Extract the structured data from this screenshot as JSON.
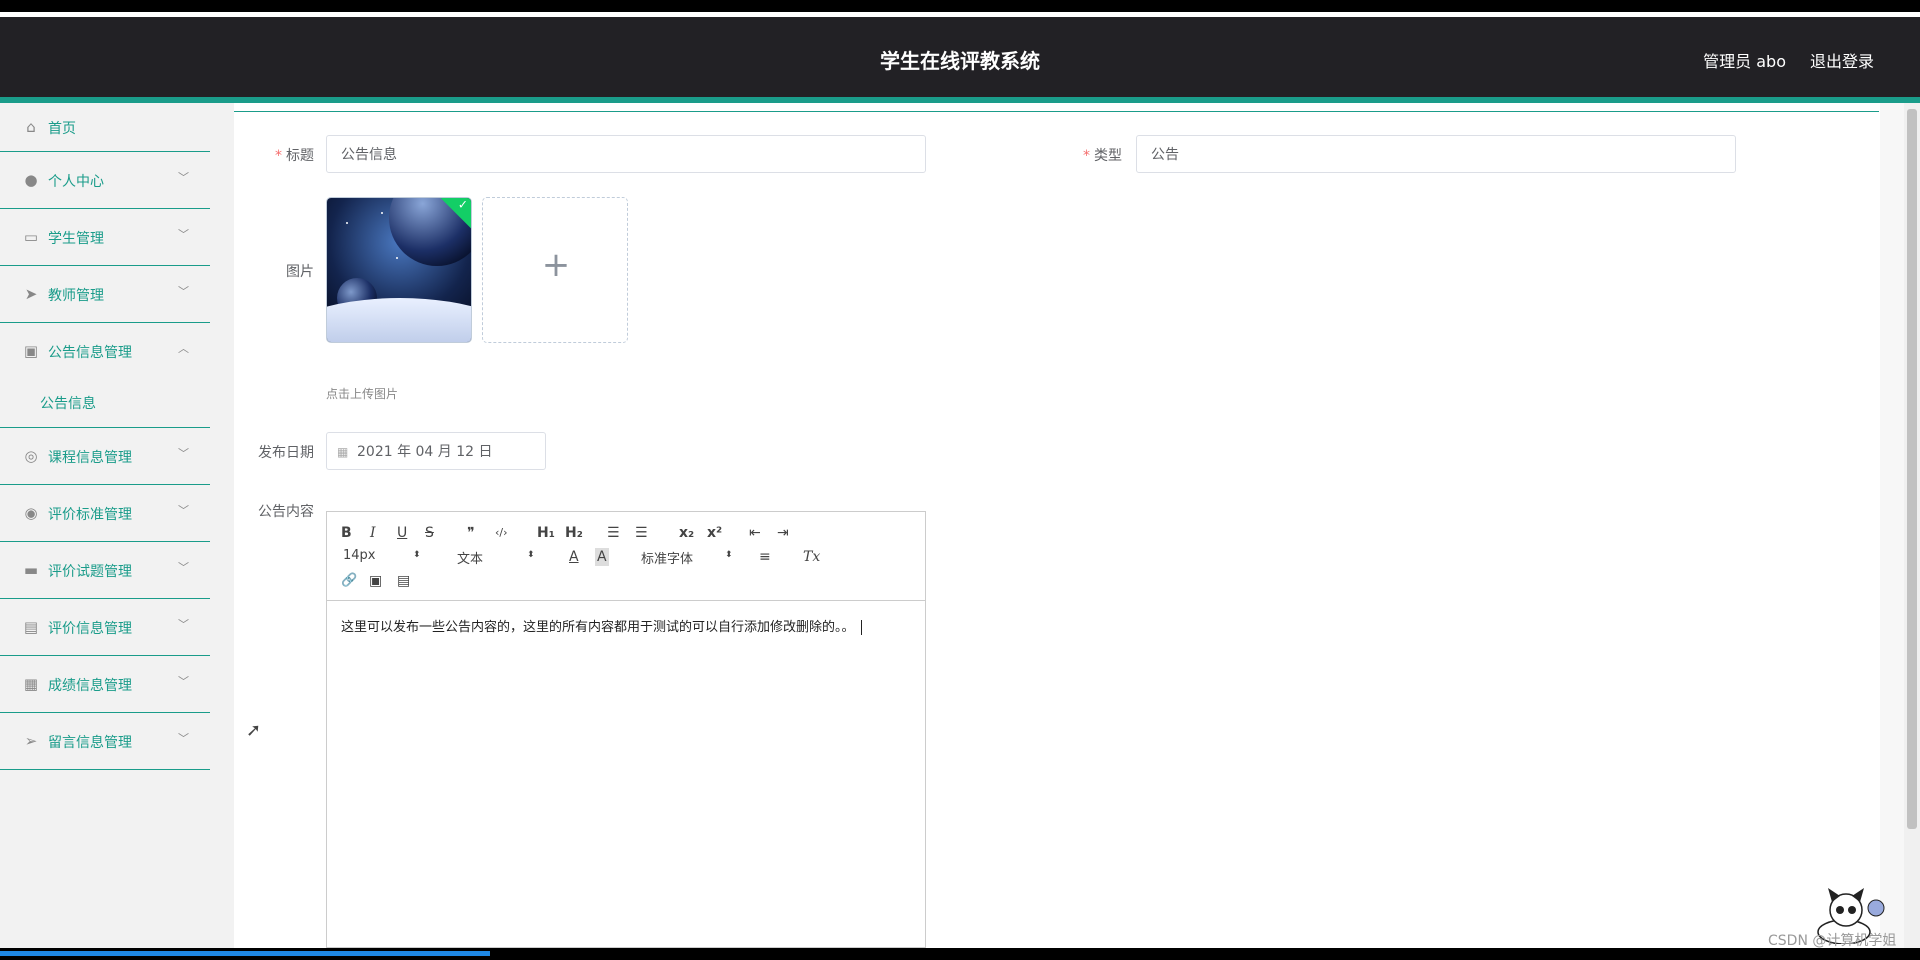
{
  "header": {
    "title": "学生在线评教系统",
    "user": "管理员 abo",
    "logout": "退出登录"
  },
  "sidebar": {
    "items": [
      {
        "label": "首页",
        "icon": "home-icon",
        "glyph": "⌂"
      },
      {
        "label": "个人中心",
        "icon": "user-icon",
        "glyph": "●"
      },
      {
        "label": "学生管理",
        "icon": "chat-icon",
        "glyph": "▭"
      },
      {
        "label": "教师管理",
        "icon": "send-icon",
        "glyph": "➤"
      },
      {
        "label": "公告信息管理",
        "icon": "briefcase-icon",
        "glyph": "▣"
      },
      {
        "label": "课程信息管理",
        "icon": "compass-icon",
        "glyph": "◎"
      },
      {
        "label": "评价标准管理",
        "icon": "target-icon",
        "glyph": "◉"
      },
      {
        "label": "评价试题管理",
        "icon": "monitor-icon",
        "glyph": "▬"
      },
      {
        "label": "评价信息管理",
        "icon": "clipboard-icon",
        "glyph": "▤"
      },
      {
        "label": "成绩信息管理",
        "icon": "grid-icon",
        "glyph": "▦"
      },
      {
        "label": "留言信息管理",
        "icon": "location-icon",
        "glyph": "➢"
      }
    ],
    "sub_item": "公告信息"
  },
  "form": {
    "title_label": "标题",
    "title_value": "公告信息",
    "type_label": "类型",
    "type_value": "公告",
    "image_label": "图片",
    "upload_hint": "点击上传图片",
    "date_label": "发布日期",
    "date_value": "2021 年 04 月 12 日",
    "content_label": "公告内容",
    "content_value": "这里可以发布一些公告内容的，这里的所有内容都用于测试的可以自行添加修改删除的。。"
  },
  "toolbar": {
    "bold": "B",
    "italic": "I",
    "underline": "U",
    "strike": "S",
    "quote": "❞",
    "code": "‹/›",
    "h1": "H₁",
    "h2": "H₂",
    "ol": "☰",
    "ul": "☰",
    "sub": "x₂",
    "sup": "x²",
    "outdent": "⇤",
    "indent": "⇥",
    "size": "14px",
    "header_sel": "文本",
    "color": "A",
    "bg": "A",
    "font": "标准字体",
    "align": "≡",
    "clean": "Tx",
    "link": "🔗",
    "image": "▣",
    "video": "▤"
  },
  "watermark": "CSDN @计算机学姐"
}
